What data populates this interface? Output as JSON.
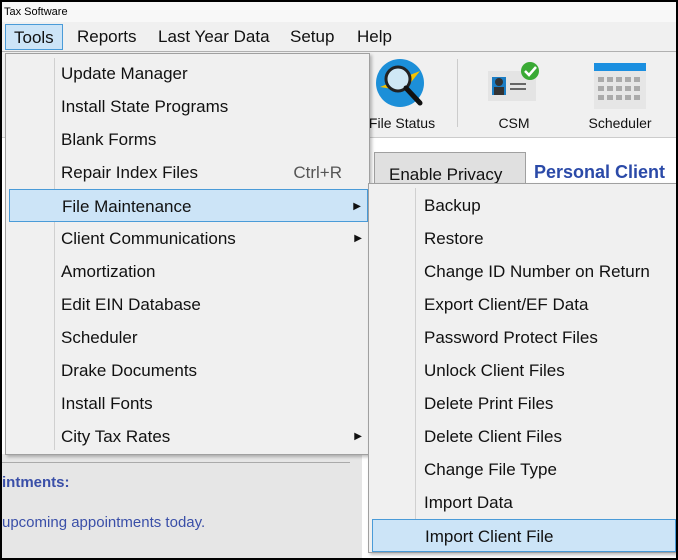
{
  "window": {
    "title": "Tax Software"
  },
  "menubar": [
    "Tools",
    "Reports",
    "Last Year Data",
    "Setup",
    "Help"
  ],
  "toolbar": {
    "file_status": "File Status",
    "csm": "CSM",
    "scheduler": "Scheduler"
  },
  "main": {
    "tab_enable_privacy": "Enable Privacy",
    "personal_client": "Personal Client",
    "appointments_heading": "intments:",
    "appointments_text": "upcoming appointments today."
  },
  "tools_menu": [
    {
      "label": "Update Manager"
    },
    {
      "label": "Install State Programs"
    },
    {
      "label": "Blank Forms"
    },
    {
      "label": "Repair Index Files",
      "shortcut": "Ctrl+R"
    },
    {
      "label": "File Maintenance",
      "submenu": true,
      "highlighted": true
    },
    {
      "label": "Client Communications",
      "submenu": true
    },
    {
      "label": "Amortization"
    },
    {
      "label": "Edit EIN Database"
    },
    {
      "label": "Scheduler"
    },
    {
      "label": "Drake Documents"
    },
    {
      "label": "Install Fonts"
    },
    {
      "label": "City Tax Rates",
      "submenu": true
    }
  ],
  "file_maintenance_menu": [
    {
      "label": "Backup"
    },
    {
      "label": "Restore"
    },
    {
      "label": "Change ID Number on Return"
    },
    {
      "label": "Export Client/EF Data"
    },
    {
      "label": "Password Protect Files"
    },
    {
      "label": "Unlock Client Files"
    },
    {
      "label": "Delete Print Files"
    },
    {
      "label": "Delete Client Files"
    },
    {
      "label": "Change File Type"
    },
    {
      "label": "Import Data"
    },
    {
      "label": "Import Client File",
      "highlighted": true
    }
  ],
  "colors": {
    "highlight": "#cce4f7",
    "highlight_border": "#4a9bd8",
    "accent_text": "#2b4aa8"
  }
}
